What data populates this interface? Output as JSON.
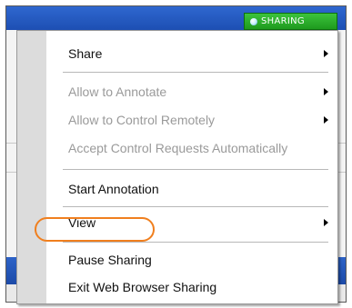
{
  "status_badge": {
    "label": "SHARING",
    "color": "#22a722"
  },
  "menu": {
    "items": [
      {
        "label": "Share",
        "enabled": true,
        "has_submenu": true
      },
      {
        "label": "Allow to Annotate",
        "enabled": false,
        "has_submenu": true
      },
      {
        "label": "Allow to Control Remotely",
        "enabled": false,
        "has_submenu": true
      },
      {
        "label": "Accept Control Requests Automatically",
        "enabled": false,
        "has_submenu": false
      },
      {
        "label": "Start Annotation",
        "enabled": true,
        "has_submenu": false
      },
      {
        "label": "View",
        "enabled": true,
        "has_submenu": true
      },
      {
        "label": "Pause Sharing",
        "enabled": true,
        "has_submenu": false,
        "highlighted": true
      },
      {
        "label": "Exit Web Browser Sharing",
        "enabled": true,
        "has_submenu": false
      }
    ],
    "highlight_color": "#f07f1e"
  }
}
